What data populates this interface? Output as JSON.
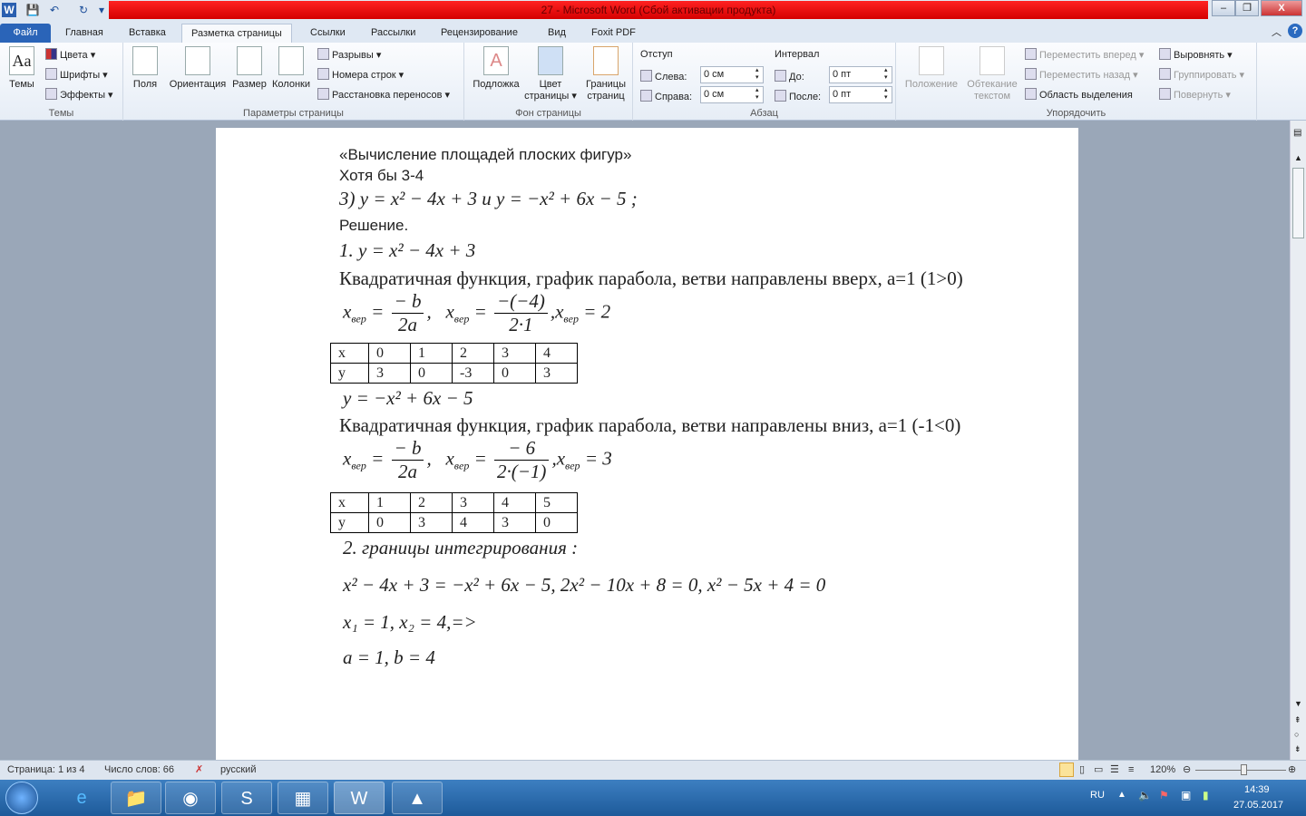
{
  "window": {
    "title": "27  -  Microsoft Word (Сбой активации продукта)",
    "minimize": "–",
    "restore": "❐",
    "close": "X"
  },
  "quick_access": {
    "app": "W",
    "save": "💾",
    "undo": "↶",
    "redo": "↻",
    "customize": "▾"
  },
  "tabs": [
    "Файл",
    "Главная",
    "Вставка",
    "Разметка страницы",
    "Ссылки",
    "Рассылки",
    "Рецензирование",
    "Вид",
    "Foxit PDF"
  ],
  "ribbon": {
    "themes": {
      "label": "Темы",
      "themes": "Темы",
      "colors": "Цвета ▾",
      "fonts": "Шрифты ▾",
      "effects": "Эффекты ▾"
    },
    "page_setup": {
      "label": "Параметры страницы",
      "margins": "Поля",
      "orientation": "Ориентация",
      "size": "Размер",
      "columns": "Колонки",
      "breaks": "Разрывы ▾",
      "line_numbers": "Номера строк ▾",
      "hyphenation": "Расстановка переносов ▾"
    },
    "background": {
      "label": "Фон страницы",
      "watermark": "Подложка",
      "page_color": "Цвет страницы ▾",
      "borders": "Границы страниц"
    },
    "paragraph": {
      "label": "Абзац",
      "indent": "Отступ",
      "left": "Слева:",
      "left_val": "0 см",
      "right": "Справа:",
      "right_val": "0 см",
      "spacing": "Интервал",
      "before": "До:",
      "before_val": "0 пт",
      "after": "После:",
      "after_val": "0 пт"
    },
    "arrange": {
      "label": "Упорядочить",
      "position": "Положение",
      "wrap": "Обтекание текстом",
      "forward": "Переместить вперед ▾",
      "backward": "Переместить назад ▾",
      "selection": "Область выделения",
      "align": "Выровнять ▾",
      "group": "Группировать ▾",
      "rotate": "Повернуть ▾"
    }
  },
  "doc": {
    "title": "«Вычисление площадей плоских фигур»",
    "subtitle": "Хотя бы 3-4",
    "task": "3) y = x² − 4x + 3   и   y = −x² + 6x − 5 ;",
    "solution": "Решение.",
    "f1": "1.  y = x² − 4x + 3",
    "f1_desc": "Квадратичная функция, график парабола, ветви направлены вверх, а=1 (1>0)",
    "xv": "x",
    "xv_sub": "вер",
    "eq": "=",
    "neg_b": "− b",
    "two_a": "2a",
    "comma": ",",
    "f1_num": "−(−4)",
    "f1_den": "2·1",
    "f1_res": "= 2",
    "table1": {
      "x": [
        "x",
        "0",
        "1",
        "2",
        "3",
        "4"
      ],
      "y": [
        "y",
        "3",
        "0",
        "-3",
        "0",
        "3"
      ]
    },
    "f2": "y = −x² + 6x − 5",
    "f2_desc": "Квадратичная функция, график парабола, ветви направлены вниз, а=1 (-1<0)",
    "f2_num": "− 6",
    "f2_den": "2·(−1)",
    "f2_res": "= 3",
    "table2": {
      "x": [
        "x",
        "1",
        "2",
        "3",
        "4",
        "5"
      ],
      "y": [
        "y",
        "0",
        "3",
        "4",
        "3",
        "0"
      ]
    },
    "step2": "2.   границы интегрирования :",
    "eqs": "x² − 4x + 3 = −x² + 6x − 5,    2x² − 10x + 8 = 0,    x² − 5x + 4 = 0",
    "roots": "x₁ = 1,    x₂ = 4,=>",
    "limits": "a = 1, b = 4"
  },
  "status": {
    "page": "Страница: 1 из 4",
    "words": "Число слов: 66",
    "lang": "русский",
    "zoom": "120%"
  },
  "taskbar": {
    "lang": "RU",
    "time": "14:39",
    "date": "27.05.2017"
  }
}
